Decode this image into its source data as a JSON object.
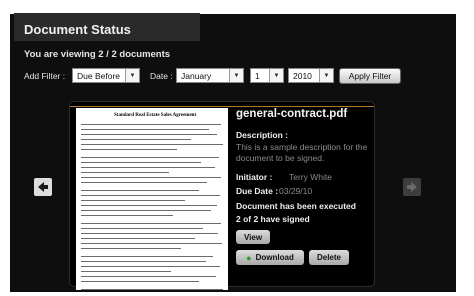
{
  "header": {
    "title": "Document Status",
    "viewing": "You are viewing  2 / 2 documents"
  },
  "filter": {
    "add_filter_label": "Add Filter :",
    "filter_type": "Due Before",
    "date_label": "Date :",
    "month": "January",
    "day": "1",
    "year": "2010",
    "apply_label": "Apply Filter"
  },
  "document": {
    "filename": "general-contract.pdf",
    "description_label": "Description :",
    "description": "This is a sample description for the document to be signed.",
    "initiator_label": "Initiator :",
    "initiator": "Terry White",
    "due_label": "Due Date :",
    "due_date": "03/29/10",
    "executed": "Document has been executed",
    "signed": "2 of 2 have signed",
    "thumbnail_heading": "Standard Real Estate Sales Agreement"
  },
  "actions": {
    "view": "View",
    "download": "Download",
    "delete": "Delete"
  },
  "colors": {
    "background": "#0e0e0e",
    "accent_line": "#b57a32",
    "download_plus": "#2e9d2e"
  },
  "icons": [
    "prev-arrow-icon",
    "next-arrow-icon",
    "plus-icon",
    "dropdown-arrow-icon"
  ]
}
